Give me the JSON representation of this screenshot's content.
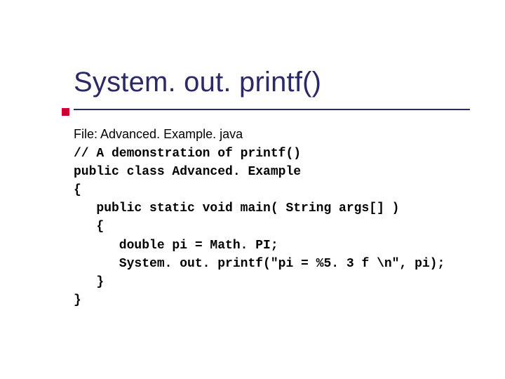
{
  "title": "System. out. printf()",
  "file_label": "File:  Advanced. Example. java",
  "code_lines": [
    "// A demonstration of printf()",
    "public class Advanced. Example",
    "{",
    "   public static void main( String args[] )",
    "   {",
    "      double pi = Math. PI;",
    "      System. out. printf(\"pi = %5. 3 f \\n\", pi);",
    "   }",
    "}"
  ]
}
